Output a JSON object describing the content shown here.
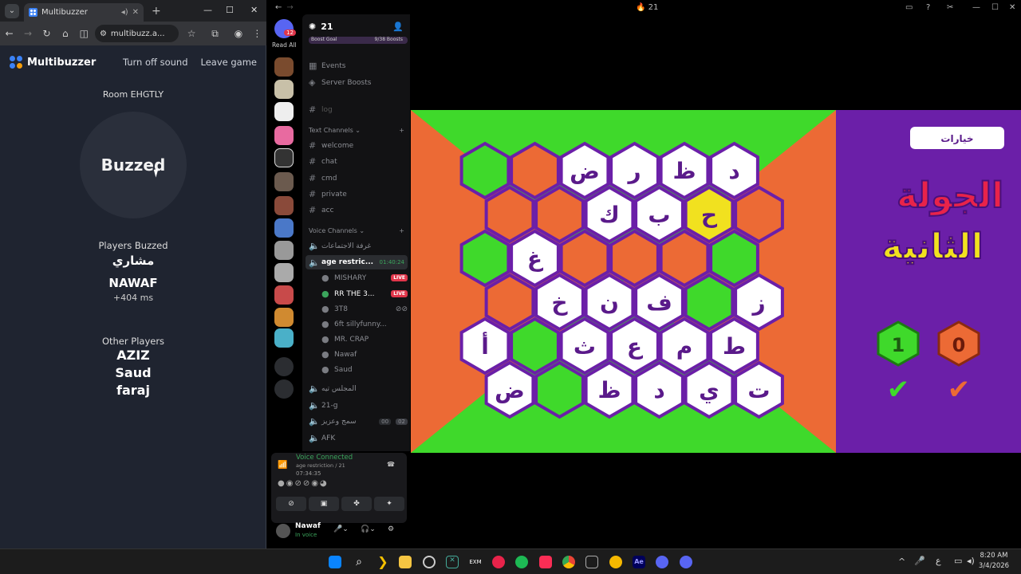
{
  "browser": {
    "tab_title": "Multibuzzer",
    "url": "multibuzz.a..."
  },
  "app": {
    "brand": "Multibuzzer",
    "turn_off_sound": "Turn off sound",
    "leave_game": "Leave game",
    "room": "Room EHGTLY",
    "buzz_label": "Buzzed"
  },
  "players_buzzed": {
    "title": "Players Buzzed",
    "p1": "مشاري",
    "p2": "NAWAF",
    "p2_time": "+404 ms"
  },
  "other_players": {
    "title": "Other Players",
    "p1": "AZIZ",
    "p2": "Saud",
    "p3": "faraj"
  },
  "discord": {
    "window_title": "21",
    "server": "21",
    "read_all": "Read All",
    "read_badge": "12",
    "boost_goal": "Boost Goal",
    "boosts": "9/38 Boosts",
    "events": "Events",
    "server_boosts": "Server Boosts",
    "log": "log",
    "text_channels": "Text Channels",
    "channels": [
      "welcome",
      "chat",
      "cmd",
      "private",
      "acc"
    ],
    "voice_channels": "Voice Channels",
    "vc_meetings": "غرفة الاجتماعات",
    "vc_age": "age restric...",
    "vc_time": "01:40:24",
    "members": [
      "MISHARY",
      "RR THE 3...",
      "3T8",
      "6ft sillyfunny...",
      "MR. CRAP",
      "Nawaf",
      "Saud"
    ],
    "live": "LIVE",
    "vc_majlis": "المجلس تيه",
    "vc_21g": "21-g",
    "vc_listen": "سمج وعزيز",
    "vc_listen_a": "00",
    "vc_listen_b": "02",
    "vc_afk": "AFK",
    "voice_connected": "Voice Connected",
    "voice_channel": "age restriction / 21",
    "voice_time": "07:34:35",
    "user_name": "Nawaf",
    "user_status": "In voice"
  },
  "game": {
    "options_btn": "خيارات",
    "round_line1": "الجولة",
    "round_line2": "الثانية",
    "score_green": "1",
    "score_orange": "0",
    "row1": [
      "",
      "",
      "ض",
      "ر",
      "ظ",
      "د"
    ],
    "row2": [
      "",
      "",
      "ك",
      "ب",
      "ح",
      ""
    ],
    "row3": [
      "",
      "غ",
      "",
      "",
      "",
      ""
    ],
    "row4": [
      "",
      "خ",
      "ن",
      "ف",
      "",
      "ز"
    ],
    "row5": [
      "أ",
      "",
      "ث",
      "ع",
      "م",
      "ط"
    ],
    "row6": [
      "ض",
      "",
      "ظ",
      "د",
      "ي",
      "ت"
    ],
    "colors": {
      "green": "#3fd92b",
      "orange": "#ec6a35",
      "purple": "#6b1fa8",
      "yellow": "#f1e11f"
    }
  },
  "taskbar": {
    "time": "8:20 AM",
    "date": "3/4/2026",
    "lang": "ع"
  }
}
